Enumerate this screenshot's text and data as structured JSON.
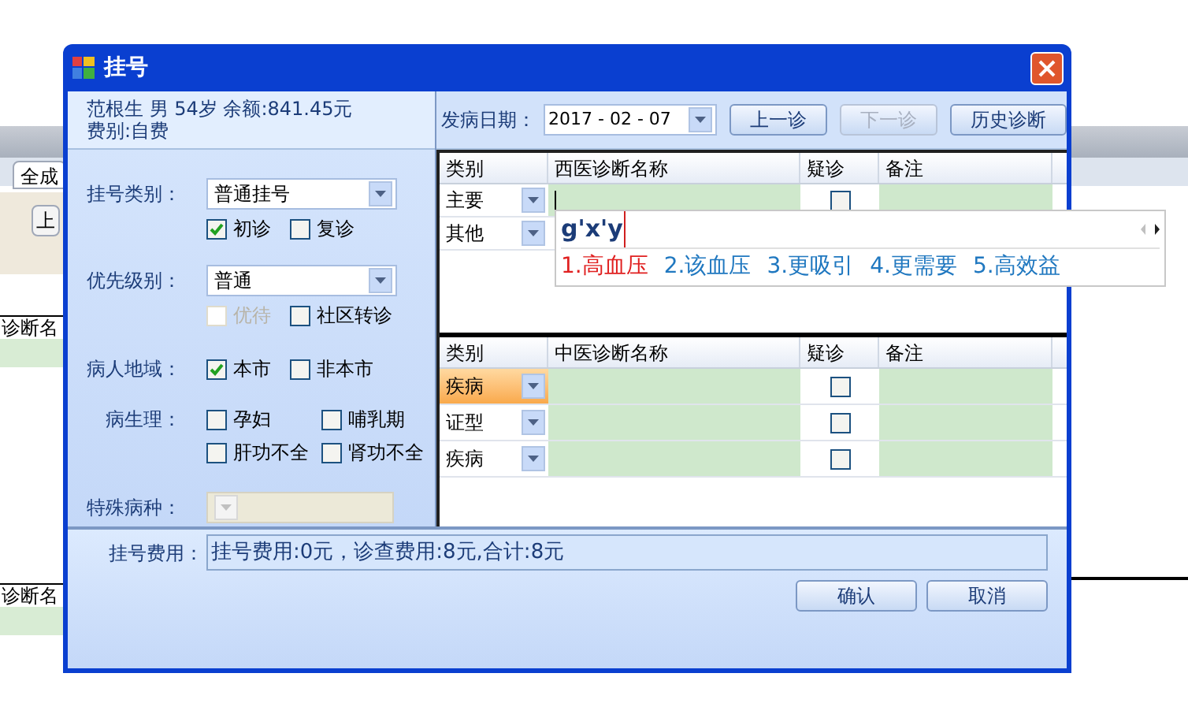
{
  "background_window": {
    "tab": "全成",
    "button": "上",
    "column_headers": [
      "诊断名",
      "诊断名"
    ]
  },
  "window": {
    "title": "挂号"
  },
  "patient": {
    "line_1": "范根生 男 54岁 余额:841.45元",
    "line_2": "费别:自费"
  },
  "registration_type": {
    "label": "挂号类别：",
    "value": "普通挂号"
  },
  "visit_options": [
    {
      "label": "初诊",
      "checked": true,
      "disabled": false
    },
    {
      "label": "复诊",
      "checked": false,
      "disabled": false
    }
  ],
  "priority": {
    "label": "优先级别：",
    "value": "普通"
  },
  "priority_options": [
    {
      "label": "优待",
      "checked": false,
      "disabled": true
    },
    {
      "label": "社区转诊",
      "checked": false,
      "disabled": false
    }
  ],
  "region": {
    "label": "病人地域：",
    "options": [
      {
        "label": "本市",
        "checked": true,
        "disabled": false
      },
      {
        "label": "非本市",
        "checked": false,
        "disabled": false
      }
    ]
  },
  "physiology": {
    "label": "病生理：",
    "options": [
      {
        "label": "孕妇",
        "checked": false,
        "disabled": false
      },
      {
        "label": "哺乳期",
        "checked": false,
        "disabled": false
      },
      {
        "label": "肝功不全",
        "checked": false,
        "disabled": false
      },
      {
        "label": "肾功不全",
        "checked": false,
        "disabled": false
      }
    ]
  },
  "special_disease": {
    "label": "特殊病种：",
    "disabled": true
  },
  "onset": {
    "label": "发病日期：",
    "value": "2017 - 02 - 07"
  },
  "nav_buttons": [
    {
      "label": "上一诊",
      "disabled": false
    },
    {
      "label": "下一诊",
      "disabled": true
    },
    {
      "label": "历史诊断",
      "disabled": false
    }
  ],
  "western_table": {
    "columns": [
      "类别",
      "西医诊断名称",
      "疑诊",
      "备注"
    ],
    "rows": [
      {
        "category": "主要",
        "selected": false,
        "suspected": false
      },
      {
        "category": "其他",
        "selected": false
      }
    ]
  },
  "ime": {
    "composition": "g'x'y",
    "candidates": [
      {
        "label": "1.高血压",
        "selected": true
      },
      {
        "label": "2.该血压",
        "selected": false
      },
      {
        "label": "3.更吸引",
        "selected": false
      },
      {
        "label": "4.更需要",
        "selected": false
      },
      {
        "label": "5.高效益",
        "selected": false
      }
    ]
  },
  "tcm_table": {
    "columns": [
      "类别",
      "中医诊断名称",
      "疑诊",
      "备注"
    ],
    "rows": [
      {
        "category": "疾病",
        "selected": true,
        "suspected": false
      },
      {
        "category": "证型",
        "selected": false,
        "suspected": false
      },
      {
        "category": "疾病",
        "selected": false,
        "suspected": false
      }
    ]
  },
  "fee": {
    "label": "挂号费用：",
    "value": "挂号费用:0元，诊查费用:8元,合计:8元"
  },
  "buttons": [
    "确认",
    "取消"
  ]
}
